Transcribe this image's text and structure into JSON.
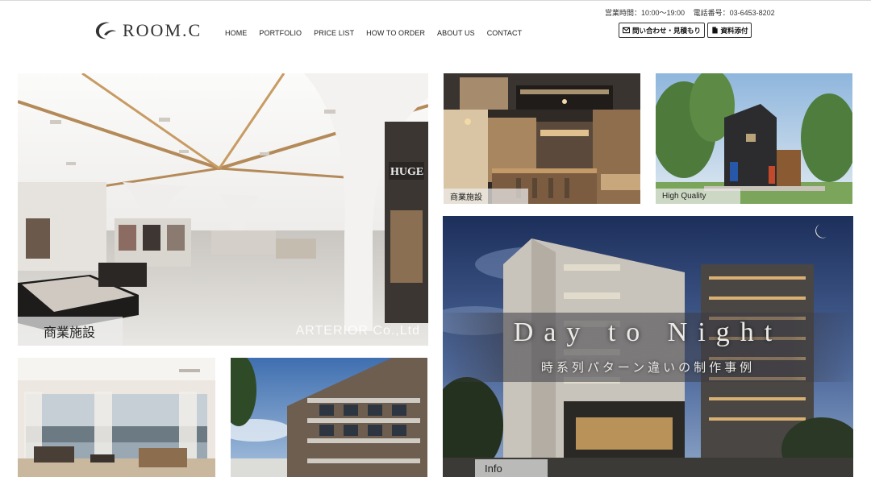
{
  "header": {
    "logo_text": "ROOM.C",
    "nav": [
      "HOME",
      "PORTFOLIO",
      "PRICE LIST",
      "HOW TO ORDER",
      "ABOUT US",
      "CONTACT"
    ],
    "hours": "営業時間：10:00～19:00",
    "phone": "電話番号：03-6453-8202",
    "inquiry_button": "問い合わせ・見積もり",
    "attach_button": "資料添付"
  },
  "tiles": {
    "main": {
      "label": "商業施設",
      "credit": "ARTERIOR Co.,Ltd",
      "store_sign": "HUGE"
    },
    "cafe": {
      "label": "商業施設"
    },
    "house": {
      "label": "High Quality"
    },
    "night": {
      "headline": "Day to Night",
      "subline": "時系列パターン違いの制作事例",
      "label": "Info"
    }
  },
  "icons": {
    "logo": "crescent-logo-icon",
    "inquiry": "mail-icon",
    "attach": "document-icon"
  }
}
